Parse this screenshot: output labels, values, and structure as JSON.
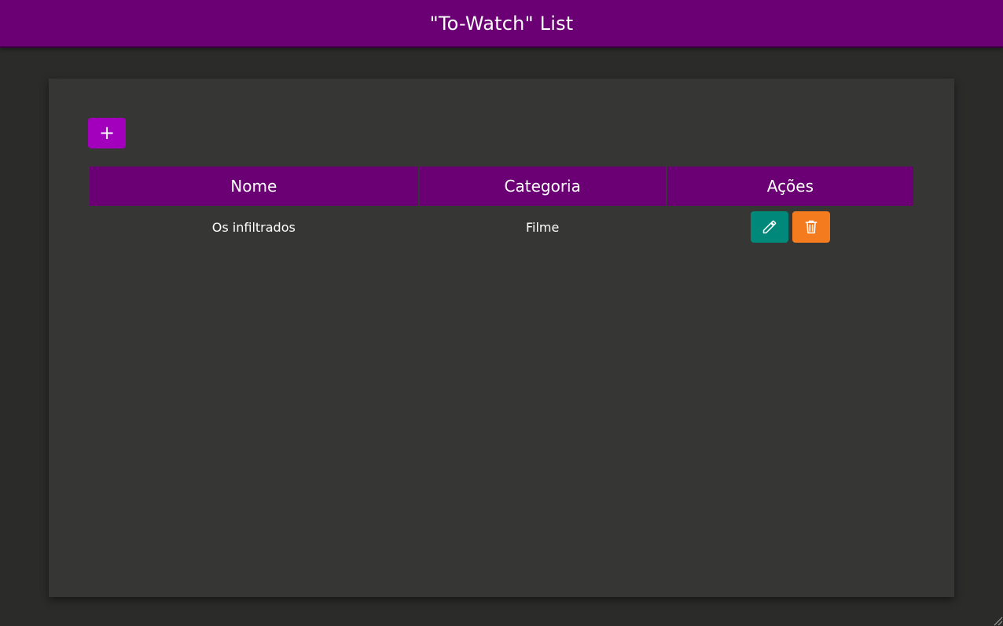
{
  "app": {
    "title": "\"To-Watch\" List"
  },
  "toolbar": {
    "add_label": "+"
  },
  "table": {
    "columns": [
      "Nome",
      "Categoria",
      "Ações"
    ],
    "rows": [
      {
        "nome": "Os infiltrados",
        "categoria": "Filme"
      }
    ]
  },
  "icons": {
    "add": "plus-icon",
    "edit": "pencil-icon",
    "delete": "trash-icon"
  },
  "colors": {
    "header_bg": "#6a0073",
    "add_button": "#a200bc",
    "edit_button": "#00897b",
    "delete_button": "#f57b1f",
    "page_bg": "#2b2b2a",
    "card_bg": "#363635"
  }
}
